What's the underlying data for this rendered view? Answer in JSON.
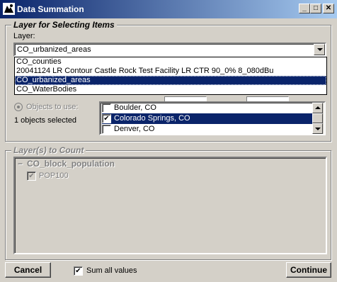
{
  "window": {
    "title": "Data Summation",
    "minimize_glyph": "_",
    "maximize_glyph": "□",
    "close_glyph": "✕"
  },
  "layer_group": {
    "legend": "Layer for Selecting Items",
    "layer_label": "Layer:",
    "combo_value": "CO_urbanized_areas",
    "dropdown_options": [
      "CO_counties",
      "20041124 LR Contour Castle Rock Test Facility LR CTR 90_0% 8_080dBu",
      "CO_urbanized_areas",
      "CO_WaterBodies"
    ],
    "dropdown_selected": "CO_urbanized_areas",
    "objects_to_use_label": "Objects to use:",
    "objects_selected_text": "1 objects selected",
    "objects": [
      {
        "label": "Boulder, CO",
        "checked": false
      },
      {
        "label": "Colorado Springs, CO",
        "checked": true
      },
      {
        "label": "Denver, CO",
        "checked": false
      }
    ]
  },
  "count_group": {
    "legend": "Layer(s) to Count",
    "tree_root": "CO_block_population",
    "tree_child": "POP100",
    "collapse_glyph": "−"
  },
  "footer": {
    "cancel_label": "Cancel",
    "sum_all_label": "Sum all values",
    "sum_all_checked": true,
    "continue_label": "Continue"
  },
  "check_glyph": "✔"
}
